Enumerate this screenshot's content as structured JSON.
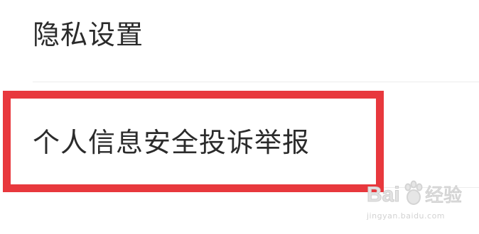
{
  "menu": {
    "privacy_settings_label": "隐私设置",
    "personal_info_complaint_label": "个人信息安全投诉举报"
  },
  "highlight": {
    "color": "#e8383d"
  },
  "watermark": {
    "brand_text": "Bai 经验",
    "url_text": "jingyan.baidu.com"
  }
}
